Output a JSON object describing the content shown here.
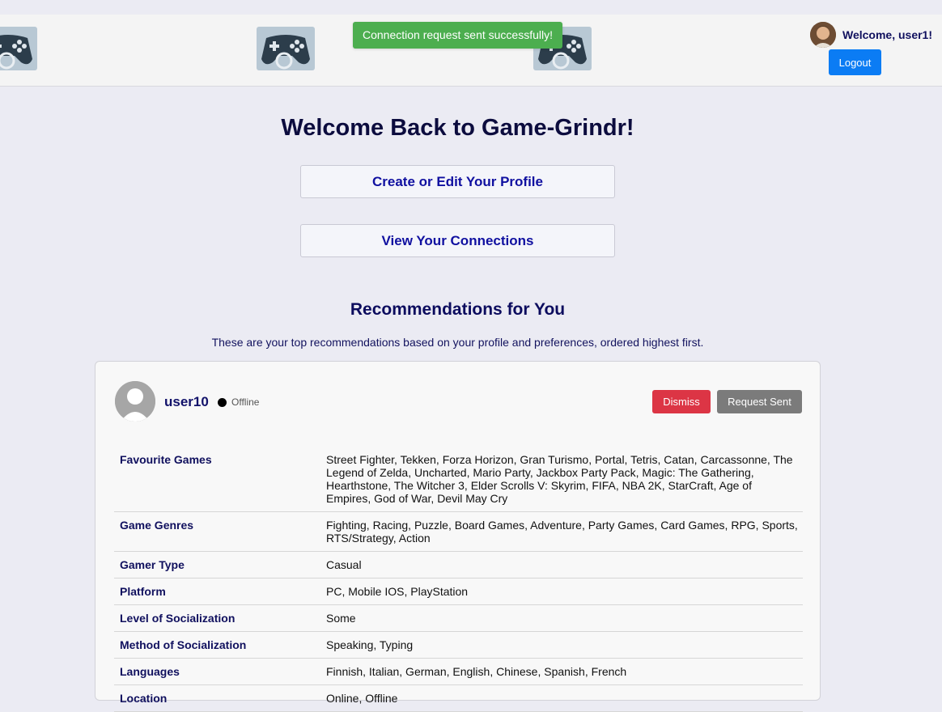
{
  "header": {
    "toast": "Connection request sent successfully!",
    "welcome": "Welcome, user1!",
    "logout_label": "Logout"
  },
  "main": {
    "title": "Welcome Back to Game-Grindr!",
    "create_profile_label": "Create or Edit Your Profile",
    "view_connections_label": "View Your Connections"
  },
  "recommendations": {
    "title": "Recommendations for You",
    "subtitle": "These are your top recommendations based on your profile and preferences, ordered highest first.",
    "card": {
      "username": "user10",
      "status": "Offline",
      "dismiss_label": "Dismiss",
      "request_label": "Request Sent",
      "details": [
        {
          "label": "Favourite Games",
          "value": "Street Fighter, Tekken, Forza Horizon, Gran Turismo, Portal, Tetris, Catan, Carcassonne, The Legend of Zelda, Uncharted, Mario Party, Jackbox Party Pack, Magic: The Gathering, Hearthstone, The Witcher 3, Elder Scrolls V: Skyrim, FIFA, NBA 2K, StarCraft, Age of Empires, God of War, Devil May Cry"
        },
        {
          "label": "Game Genres",
          "value": "Fighting, Racing, Puzzle, Board Games, Adventure, Party Games, Card Games, RPG, Sports, RTS/Strategy, Action"
        },
        {
          "label": "Gamer Type",
          "value": "Casual"
        },
        {
          "label": "Platform",
          "value": "PC, Mobile IOS, PlayStation"
        },
        {
          "label": "Level of Socialization",
          "value": "Some"
        },
        {
          "label": "Method of Socialization",
          "value": "Speaking, Typing"
        },
        {
          "label": "Languages",
          "value": "Finnish, Italian, German, English, Chinese, Spanish, French"
        },
        {
          "label": "Location",
          "value": "Online, Offline"
        }
      ]
    }
  }
}
